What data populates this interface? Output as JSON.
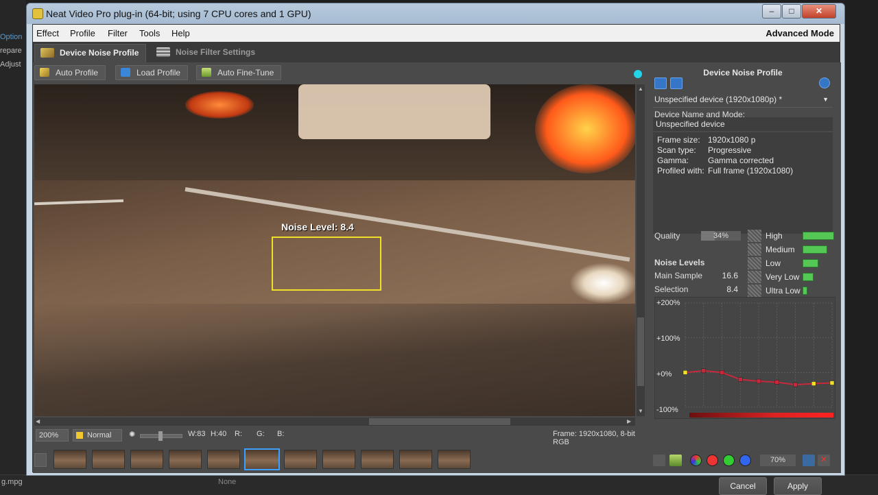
{
  "host": {
    "left_labels": [
      "Option",
      "repare",
      "Adjust"
    ],
    "bottom_file": "g.mpg",
    "bottom_none": "None"
  },
  "window": {
    "title": "Neat Video Pro plug-in (64-bit; using 7 CPU cores and 1 GPU)",
    "minimize": "–",
    "maximize": "□",
    "close": "✕"
  },
  "menu": {
    "items": [
      "Effect",
      "Profile",
      "Filter",
      "Tools",
      "Help"
    ],
    "mode": "Advanced Mode"
  },
  "tabs": [
    {
      "label": "Device Noise Profile",
      "active": true
    },
    {
      "label": "Noise Filter Settings",
      "active": false
    }
  ],
  "toolbar": {
    "auto_profile": "Auto Profile",
    "load_profile": "Load Profile",
    "auto_fine_tune": "Auto Fine-Tune"
  },
  "viewer": {
    "noise_label": "Noise Level: 8.4"
  },
  "statusbar": {
    "zoom": "200%",
    "blend": "Normal",
    "w": "W:83",
    "h": "H:40",
    "r": "R:",
    "g": "G:",
    "b": "B:",
    "frame_info": "Frame: 1920x1080, 8-bit RGB"
  },
  "panel": {
    "title": "Device Noise Profile",
    "device_select": "Unspecified device (1920x1080p) *",
    "device_name_label": "Device Name and Mode:",
    "device_name": "Unspecified device",
    "info": [
      {
        "k": "Frame size:",
        "v": "1920x1080 p"
      },
      {
        "k": "Scan type:",
        "v": "Progressive"
      },
      {
        "k": "Gamma:",
        "v": "Gamma corrected"
      },
      {
        "k": "Profiled with:",
        "v": "Full frame (1920x1080)"
      }
    ],
    "quality_label": "Quality",
    "quality_value": "34%",
    "quality_fraction": 0.34,
    "noise_levels_label": "Noise Levels",
    "main_sample_label": "Main Sample",
    "main_sample_value": "16.6",
    "selection_label": "Selection",
    "selection_value": "8.4",
    "levels": [
      {
        "label": "High",
        "fraction": 1.0
      },
      {
        "label": "Medium",
        "fraction": 0.78
      },
      {
        "label": "Low",
        "fraction": 0.5
      },
      {
        "label": "Very Low",
        "fraction": 0.35
      },
      {
        "label": "Ultra Low",
        "fraction": 0.15
      }
    ],
    "graph_labels": [
      "+200%",
      "+100%",
      "+0%",
      "-100%"
    ],
    "curve_values": [
      0,
      5,
      0,
      -20,
      -25,
      -28,
      -35,
      -32,
      -30
    ],
    "percent": "70%",
    "cancel": "Cancel",
    "apply": "Apply"
  },
  "colors": {
    "accent": "#22d4e8",
    "selection_box": "#f0e02a",
    "level_bar": "#55c755",
    "curve": "#c8283c"
  }
}
